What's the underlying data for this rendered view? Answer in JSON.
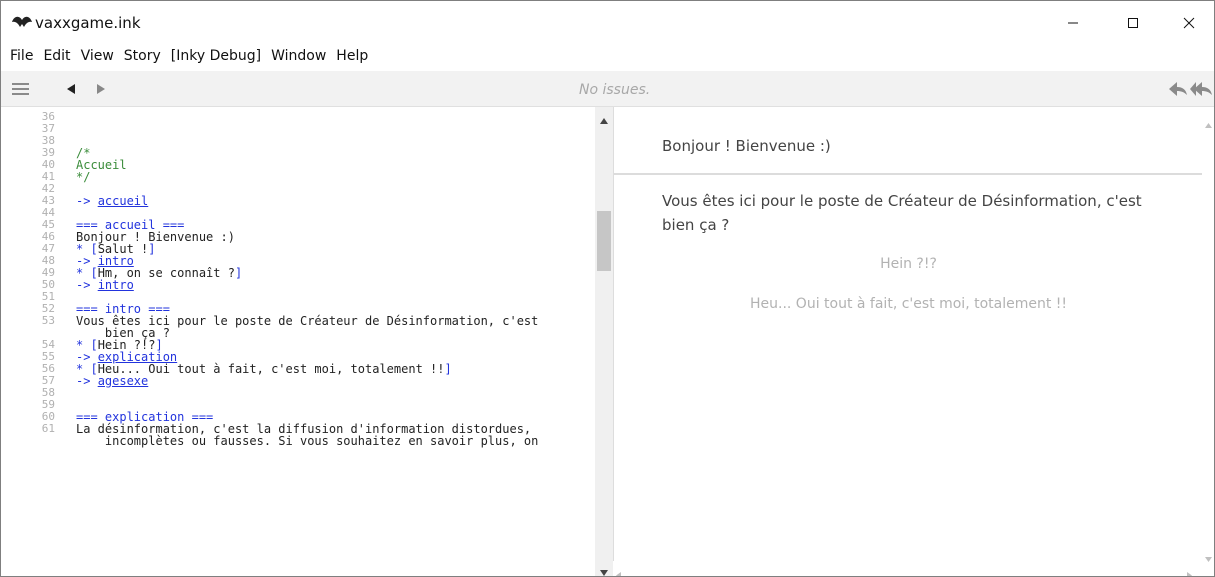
{
  "window": {
    "title": "vaxxgame.ink",
    "minimize_glyph": "—",
    "maximize_glyph": "☐",
    "close_glyph": "✕"
  },
  "menu": [
    "File",
    "Edit",
    "View",
    "Story",
    "[Inky Debug]",
    "Window",
    "Help"
  ],
  "toolbar": {
    "status": "No issues."
  },
  "editor": {
    "lines": [
      {
        "n": "36",
        "segs": []
      },
      {
        "n": "37",
        "segs": []
      },
      {
        "n": "38",
        "segs": []
      },
      {
        "n": "39",
        "segs": [
          {
            "t": "/*",
            "c": "comment"
          }
        ]
      },
      {
        "n": "40",
        "segs": [
          {
            "t": "Accueil",
            "c": "comment"
          }
        ]
      },
      {
        "n": "41",
        "segs": [
          {
            "t": "*/",
            "c": "comment"
          }
        ]
      },
      {
        "n": "42",
        "segs": []
      },
      {
        "n": "43",
        "segs": [
          {
            "t": "-> ",
            "c": "divert"
          },
          {
            "t": "accueil",
            "c": "link"
          }
        ]
      },
      {
        "n": "44",
        "segs": []
      },
      {
        "n": "45",
        "segs": [
          {
            "t": "=== accueil ===",
            "c": "knot"
          }
        ]
      },
      {
        "n": "46",
        "segs": [
          {
            "t": "Bonjour ! Bienvenue :)",
            "c": "text"
          }
        ]
      },
      {
        "n": "47",
        "segs": [
          {
            "t": "* [",
            "c": "choice"
          },
          {
            "t": "Salut !",
            "c": "text"
          },
          {
            "t": "]",
            "c": "choice"
          }
        ]
      },
      {
        "n": "48",
        "segs": [
          {
            "t": "-> ",
            "c": "divert"
          },
          {
            "t": "intro",
            "c": "link"
          }
        ]
      },
      {
        "n": "49",
        "segs": [
          {
            "t": "* [",
            "c": "choice"
          },
          {
            "t": "Hm, on se connaît ?",
            "c": "text"
          },
          {
            "t": "]",
            "c": "choice"
          }
        ]
      },
      {
        "n": "50",
        "segs": [
          {
            "t": "-> ",
            "c": "divert"
          },
          {
            "t": "intro",
            "c": "link"
          }
        ]
      },
      {
        "n": "51",
        "segs": []
      },
      {
        "n": "52",
        "segs": [
          {
            "t": "=== intro ===",
            "c": "knot"
          }
        ]
      },
      {
        "n": "53",
        "segs": [
          {
            "t": "Vous êtes ici pour le poste de Créateur de Désinformation, c'est",
            "c": "text"
          }
        ]
      },
      {
        "n": "",
        "segs": [
          {
            "t": "    bien ça ?",
            "c": "text"
          }
        ]
      },
      {
        "n": "54",
        "segs": [
          {
            "t": "* [",
            "c": "choice"
          },
          {
            "t": "Hein ?!?",
            "c": "text"
          },
          {
            "t": "]",
            "c": "choice"
          }
        ]
      },
      {
        "n": "55",
        "segs": [
          {
            "t": "-> ",
            "c": "divert"
          },
          {
            "t": "explication",
            "c": "link"
          }
        ]
      },
      {
        "n": "56",
        "segs": [
          {
            "t": "* [",
            "c": "choice"
          },
          {
            "t": "Heu... Oui tout à fait, c'est moi, totalement !!",
            "c": "text"
          },
          {
            "t": "]",
            "c": "choice"
          }
        ]
      },
      {
        "n": "57",
        "segs": [
          {
            "t": "-> ",
            "c": "divert"
          },
          {
            "t": "agesexe",
            "c": "link"
          }
        ]
      },
      {
        "n": "58",
        "segs": []
      },
      {
        "n": "59",
        "segs": []
      },
      {
        "n": "60",
        "segs": [
          {
            "t": "=== explication ===",
            "c": "knot"
          }
        ]
      },
      {
        "n": "61",
        "segs": [
          {
            "t": "La désinformation, c'est la diffusion d'information distordues,",
            "c": "text"
          }
        ]
      },
      {
        "n": "",
        "segs": [
          {
            "t": "    incomplètes ou fausses. Si vous souhaitez en savoir plus, on",
            "c": "text"
          }
        ]
      }
    ]
  },
  "player": {
    "greeting": "Bonjour ! Bienvenue :)",
    "paragraph_line1": "Vous êtes ici pour le poste de Créateur de Désinformation, c'est",
    "paragraph_line2": "bien ça ?",
    "choices": [
      "Hein ?!?",
      "Heu... Oui tout à fait, c'est moi, totalement !!"
    ]
  },
  "icons": [
    "app-icon",
    "hamburger-menu-icon",
    "back-arrow-icon",
    "forward-arrow-icon",
    "rewind-icon",
    "restart-icon",
    "scroll-up-icon",
    "scroll-down-icon",
    "scroll-left-icon",
    "scroll-right-icon"
  ]
}
